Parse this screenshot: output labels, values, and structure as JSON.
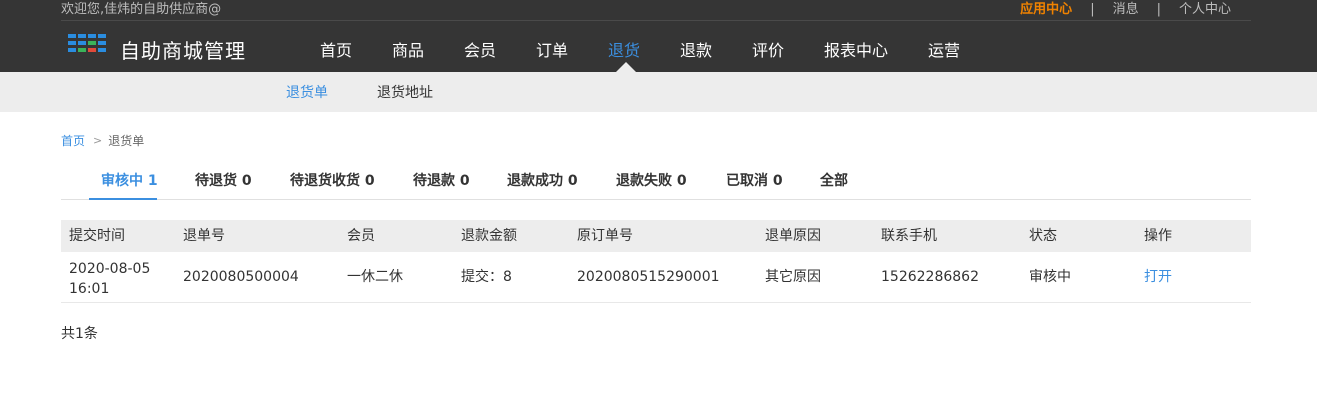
{
  "header": {
    "welcome": "欢迎您,佳炜的自助供应商@",
    "links": [
      {
        "label": "应用中心"
      },
      {
        "label": "消息"
      },
      {
        "label": "个人中心"
      }
    ],
    "separator": "|",
    "brand": "自助商城管理"
  },
  "nav": {
    "items": [
      {
        "label": "首页"
      },
      {
        "label": "商品"
      },
      {
        "label": "会员"
      },
      {
        "label": "订单"
      },
      {
        "label": "退货"
      },
      {
        "label": "退款"
      },
      {
        "label": "评价"
      },
      {
        "label": "报表中心"
      },
      {
        "label": "运营"
      }
    ],
    "active": "退货"
  },
  "subnav": {
    "items": [
      {
        "label": "退货单"
      },
      {
        "label": "退货地址"
      }
    ],
    "active": "退货单"
  },
  "breadcrumb": {
    "home": "首页",
    "arrow": ">",
    "current": "退货单"
  },
  "tabs": {
    "items": [
      {
        "label": "审核中 1"
      },
      {
        "label": "待退货 0"
      },
      {
        "label": "待退货收货 0"
      },
      {
        "label": "待退款 0"
      },
      {
        "label": "退款成功 0"
      },
      {
        "label": "退款失败 0"
      },
      {
        "label": "已取消 0"
      },
      {
        "label": "全部"
      }
    ],
    "active": "审核中 1"
  },
  "table": {
    "columns": [
      "提交时间",
      "退单号",
      "会员",
      "退款金额",
      "原订单号",
      "退单原因",
      "联系手机",
      "状态",
      "操作"
    ],
    "rows": [
      {
        "submit_time": "2020-08-05 16:01",
        "return_no": "2020080500004",
        "member": "一休二休",
        "refund_amount": "提交：8",
        "order_no": "2020080515290001",
        "reason": "其它原因",
        "phone": "15262286862",
        "status": "审核中",
        "action": "打开"
      }
    ]
  },
  "footer": {
    "total": "共1条"
  },
  "colors": {
    "topbar_bg": "#353535",
    "accent_blue": "#3b8fe0",
    "accent_orange": "#f08200",
    "subnav_bg": "#ededed"
  }
}
